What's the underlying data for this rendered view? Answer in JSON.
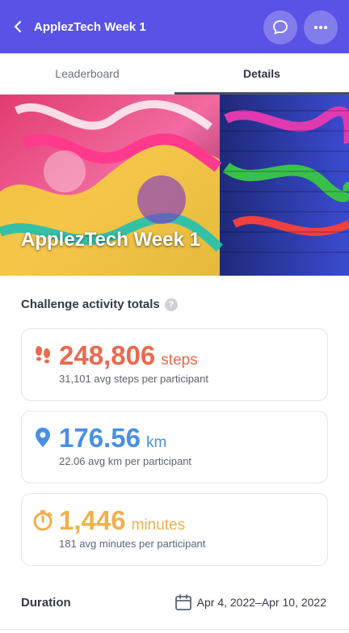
{
  "appbar": {
    "title": "ApplezTech Week 1",
    "colors": {
      "bar": "#5a52e6"
    },
    "icons": {
      "back": "back-arrow-icon",
      "chat": "chat-bubble-icon",
      "more": "more-dots-icon"
    }
  },
  "tabs": [
    {
      "label": "Leaderboard",
      "active": false
    },
    {
      "label": "Details",
      "active": true
    }
  ],
  "hero": {
    "title": "ApplezTech Week 1"
  },
  "activity": {
    "title": "Challenge activity totals",
    "help": "?",
    "cards": [
      {
        "icon": "footsteps-icon",
        "value": "248,806",
        "unit": "steps",
        "sub": "31,101 avg steps per participant",
        "color": "#ea6a4f"
      },
      {
        "icon": "location-pin-icon",
        "value": "176.56",
        "unit": "km",
        "sub": "22.06 avg km per participant",
        "color": "#4a90e2"
      },
      {
        "icon": "stopwatch-icon",
        "value": "1,446",
        "unit": "minutes",
        "sub": "181 avg minutes per participant",
        "color": "#f0b04c"
      }
    ]
  },
  "duration": {
    "label": "Duration",
    "icon": "calendar-icon",
    "value": "Apr 4, 2022–Apr 10, 2022"
  }
}
